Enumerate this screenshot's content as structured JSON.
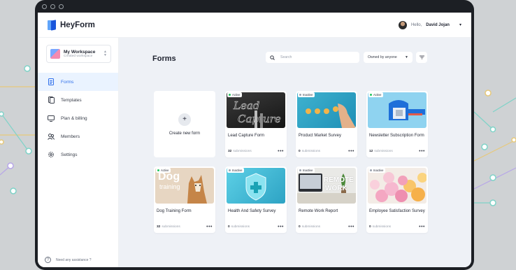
{
  "app": {
    "brand": "HeyForm",
    "brand_colors": [
      "#1a56db",
      "#60a5fa"
    ]
  },
  "user": {
    "greeting": "Hello,",
    "name": "David Jojan"
  },
  "workspace": {
    "name": "My Workspace",
    "subtitle": "Created workspace"
  },
  "nav": [
    {
      "label": "Forms",
      "icon": "document-icon",
      "active": true
    },
    {
      "label": "Templates",
      "icon": "templates-icon",
      "active": false
    },
    {
      "label": "Plan & billing",
      "icon": "monitor-icon",
      "active": false
    },
    {
      "label": "Members",
      "icon": "members-icon",
      "active": false
    },
    {
      "label": "Settings",
      "icon": "gear-icon",
      "active": false
    }
  ],
  "help": {
    "label": "Need any assistance ?"
  },
  "main": {
    "title": "Forms",
    "search_placeholder": "Search",
    "owner_filter": "Owned by anyone",
    "create_label": "Create new form"
  },
  "status_colors": {
    "active": "#22c55e",
    "inactive": "#9ca3af"
  },
  "forms": [
    {
      "title": "Lead Capture Form",
      "status": "Active",
      "submissions": "32",
      "submissions_label": "submissions",
      "thumb": "lead"
    },
    {
      "title": "Product Market Survey",
      "status": "Inactive",
      "submissions": "0",
      "submissions_label": "submissions",
      "thumb": "survey"
    },
    {
      "title": "Newsletter Subscription Form",
      "status": "Active",
      "submissions": "12",
      "submissions_label": "submissions",
      "thumb": "mail"
    },
    {
      "title": "Dog Training Form",
      "status": "Active",
      "submissions": "32",
      "submissions_label": "submissions",
      "thumb": "dog",
      "thumb_text": [
        "Dog",
        "training"
      ]
    },
    {
      "title": "Health And Safety Survey",
      "status": "Inactive",
      "submissions": "0",
      "submissions_label": "submissions",
      "thumb": "health"
    },
    {
      "title": "Remote Work Report",
      "status": "Inactive",
      "submissions": "0",
      "submissions_label": "submissions",
      "thumb": "remote",
      "thumb_text": [
        "REMOTE",
        "WORK"
      ]
    },
    {
      "title": "Employee Satisfaction Survey",
      "status": "Inactive",
      "submissions": "0",
      "submissions_label": "submissions",
      "thumb": "balloons"
    }
  ]
}
